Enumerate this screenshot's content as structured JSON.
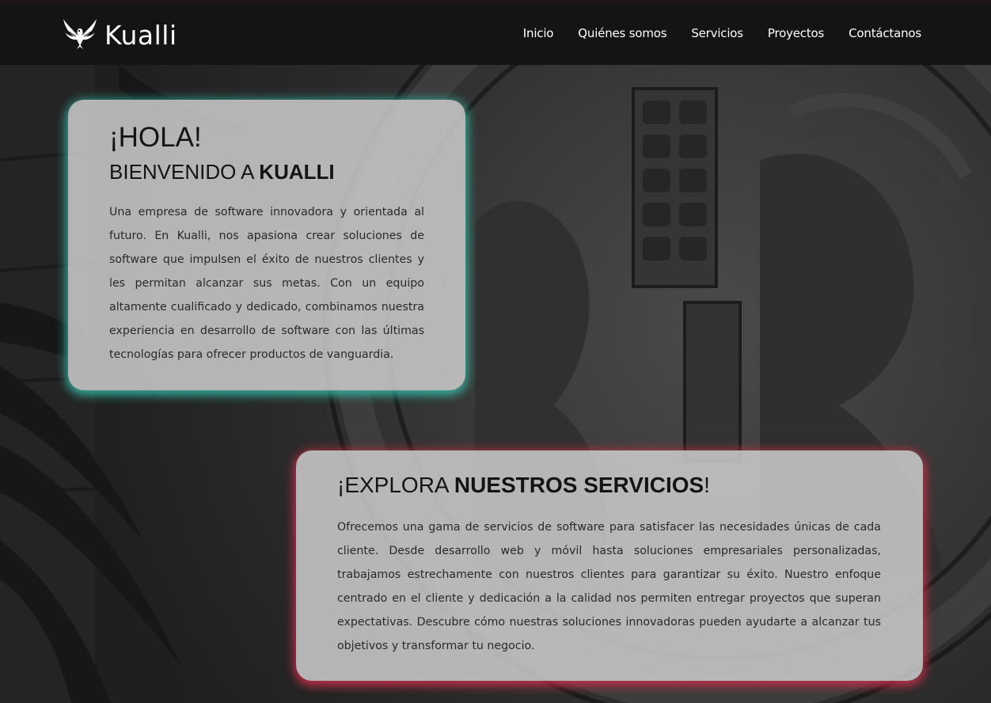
{
  "brand": {
    "name": "Kualli",
    "logo_icon": "eagle-icon"
  },
  "nav": {
    "items": [
      {
        "label": "Inicio"
      },
      {
        "label": "Quiénes somos"
      },
      {
        "label": "Servicios"
      },
      {
        "label": "Proyectos"
      },
      {
        "label": "Contáctanos"
      }
    ]
  },
  "welcome_card": {
    "greeting": "¡HOLA!",
    "welcome_prefix": "BIENVENIDO A ",
    "welcome_brand": "KUALLI",
    "body": "Una empresa de software innovadora y orientada al futuro. En Kualli, nos apasiona crear soluciones de software que impulsen el éxito de nuestros clientes y les permitan alcanzar sus metas. Con un equipo altamente cualificado y dedicado, combinamos nuestra experiencia en desarrollo de software con las últimas tecnologías para ofrecer productos de vanguardia."
  },
  "services_card": {
    "title_prefix": "¡EXPLORA ",
    "title_bold": "NUESTROS SERVICIOS",
    "title_suffix": "!",
    "body": "Ofrecemos una gama de servicios de software para satisfacer las necesidades únicas de cada cliente. Desde desarrollo web y móvil hasta soluciones empresariales personalizadas, trabajamos estrechamente con nuestros clientes para garantizar su éxito. Nuestro enfoque centrado en el cliente y dedicación a la calidad nos permiten entregar proyectos que superan expectativas. Descubre cómo nuestras soluciones innovadoras pueden ayudarte a alcanzar tus objetivos y transformar tu negocio."
  },
  "colors": {
    "navbar": "#141414",
    "welcome_glow": "#38c8b4",
    "services_glow": "#d7304e",
    "card_bg": "#cdcdcd"
  }
}
